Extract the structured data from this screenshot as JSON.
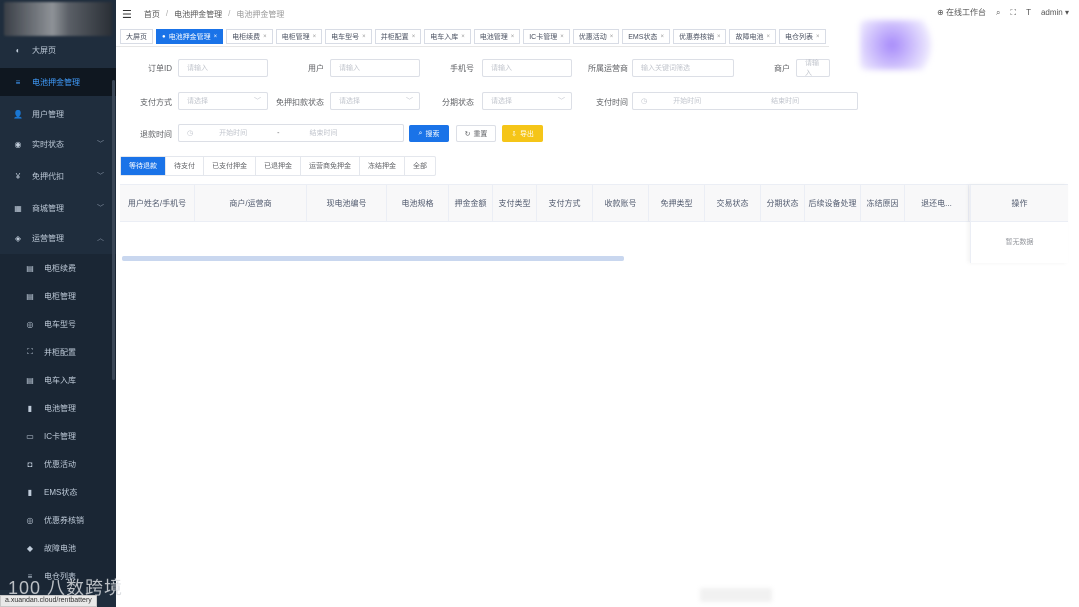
{
  "sidebar": {
    "items": [
      {
        "label": "大屏页",
        "icon": "dashboard-icon",
        "glyph": "◐"
      },
      {
        "label": "电池押金管理",
        "icon": "list-icon",
        "glyph": "≡",
        "active": true
      },
      {
        "label": "用户管理",
        "icon": "user-icon",
        "glyph": "👤"
      },
      {
        "label": "实时状态",
        "icon": "location-icon",
        "glyph": "◉",
        "arrow": "﹀"
      },
      {
        "label": "免押代扣",
        "icon": "yen-icon",
        "glyph": "¥",
        "arrow": "﹀"
      },
      {
        "label": "商城管理",
        "icon": "cart-icon",
        "glyph": "▦",
        "arrow": "﹀"
      },
      {
        "label": "运营管理",
        "icon": "shield-icon",
        "glyph": "◈",
        "arrow": "︿"
      }
    ],
    "subitems": [
      {
        "label": "电柜续费",
        "icon": "cabinet-icon",
        "glyph": "▤"
      },
      {
        "label": "电柜管理",
        "icon": "cabinet-icon",
        "glyph": "▤"
      },
      {
        "label": "电车型号",
        "icon": "model-icon",
        "glyph": "◎"
      },
      {
        "label": "并柜配置",
        "icon": "sitemap-icon",
        "glyph": "⛶"
      },
      {
        "label": "电车入库",
        "icon": "cabinet-icon",
        "glyph": "▤"
      },
      {
        "label": "电池管理",
        "icon": "battery-icon",
        "glyph": "▮"
      },
      {
        "label": "IC卡管理",
        "icon": "card-icon",
        "glyph": "▭"
      },
      {
        "label": "优惠活动",
        "icon": "gift-icon",
        "glyph": "◘"
      },
      {
        "label": "EMS状态",
        "icon": "battery-icon",
        "glyph": "▮"
      },
      {
        "label": "优惠券核销",
        "icon": "coupon-icon",
        "glyph": "◎"
      },
      {
        "label": "故障电池",
        "icon": "alert-icon",
        "glyph": "◆"
      },
      {
        "label": "电仓列表",
        "icon": "list-icon",
        "glyph": "≡"
      }
    ],
    "watermark": "100 八数跨境",
    "status_url": "a.xuandan.cloud/rentbattery"
  },
  "topbar": {
    "breadcrumb": [
      "首页",
      "电池押金管理",
      "电池押金管理"
    ],
    "right_items": [
      "在线工作台",
      "admin"
    ]
  },
  "tags": [
    {
      "label": "大屏页",
      "closable": false
    },
    {
      "label": "电池押金管理",
      "closable": true,
      "active": true
    },
    {
      "label": "电柜续费",
      "closable": true
    },
    {
      "label": "电柜管理",
      "closable": true
    },
    {
      "label": "电车型号",
      "closable": true
    },
    {
      "label": "并柜配置",
      "closable": true
    },
    {
      "label": "电车入库",
      "closable": true
    },
    {
      "label": "电池管理",
      "closable": true
    },
    {
      "label": "IC卡管理",
      "closable": true
    },
    {
      "label": "优惠活动",
      "closable": true
    },
    {
      "label": "EMS状态",
      "closable": true
    },
    {
      "label": "优惠券核销",
      "closable": true
    },
    {
      "label": "故障电池",
      "closable": true
    },
    {
      "label": "电仓列表",
      "closable": true
    }
  ],
  "filters": {
    "order_id": {
      "label": "订单ID",
      "placeholder": "请输入"
    },
    "user": {
      "label": "用户",
      "placeholder": "请输入"
    },
    "phone": {
      "label": "手机号",
      "placeholder": "请输入"
    },
    "operator": {
      "label": "所属运营商",
      "placeholder": "输入关键词筛选"
    },
    "merchant": {
      "label": "商户",
      "placeholder": "请输入"
    },
    "pay_method": {
      "label": "支付方式",
      "placeholder": "请选择"
    },
    "deduct_status": {
      "label": "免押扣款状态",
      "placeholder": "请选择"
    },
    "installment_status": {
      "label": "分期状态",
      "placeholder": "请选择"
    },
    "pay_time": {
      "label": "支付时间",
      "start": "开始时间",
      "end": "结束时间"
    },
    "refund_time": {
      "label": "退款时间",
      "start": "开始时间",
      "sep": "-",
      "end": "结束时间"
    }
  },
  "buttons": {
    "search": "搜索",
    "reset": "重置",
    "export": "导出"
  },
  "tabs": [
    "等待退款",
    "待支付",
    "已支付押金",
    "已退押金",
    "运营商免押金",
    "冻结押金",
    "全部"
  ],
  "table": {
    "columns": [
      "用户姓名/手机号",
      "商户/运营商",
      "现电池编号",
      "电池规格",
      "押金金额",
      "支付类型",
      "支付方式",
      "收款账号",
      "免押类型",
      "交易状态",
      "分期状态",
      "后续设备处理",
      "冻结原因",
      "退还电..."
    ],
    "action_header": "操作",
    "empty_text": "暂无数据"
  }
}
